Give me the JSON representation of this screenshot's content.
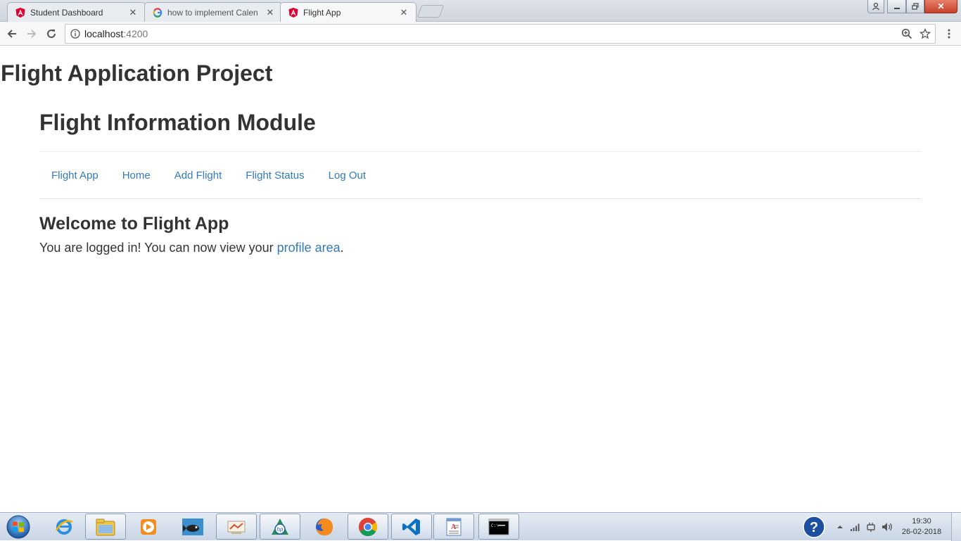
{
  "browser": {
    "tabs": [
      {
        "title": "Student Dashboard",
        "icon": "angular-icon",
        "active": false
      },
      {
        "title": "how to implement Calen",
        "icon": "google-icon",
        "active": false
      },
      {
        "title": "Flight App",
        "icon": "angular-icon",
        "active": true
      }
    ],
    "address": {
      "host": "localhost",
      "port": ":4200"
    }
  },
  "page": {
    "app_title": "Flight Application Project",
    "module_title": "Flight Information Module",
    "nav": [
      "Flight App",
      "Home",
      "Add Flight",
      "Flight Status",
      "Log Out"
    ],
    "welcome": "Welcome to Flight App",
    "message_prefix": "You are logged in! You can now view your ",
    "message_link": "profile area",
    "message_suffix": "."
  },
  "taskbar": {
    "apps": [
      "internet-explorer-icon",
      "windows-explorer-icon",
      "media-player-icon",
      "photo-viewer-icon",
      "presentation-icon",
      "hp-icon",
      "firefox-icon",
      "chrome-icon",
      "visual-studio-icon",
      "wordpad-icon",
      "command-prompt-icon"
    ],
    "time": "19:30",
    "date": "26-02-2018"
  },
  "colors": {
    "link": "#337ab7",
    "text": "#333333",
    "angular_red": "#dd0031"
  }
}
